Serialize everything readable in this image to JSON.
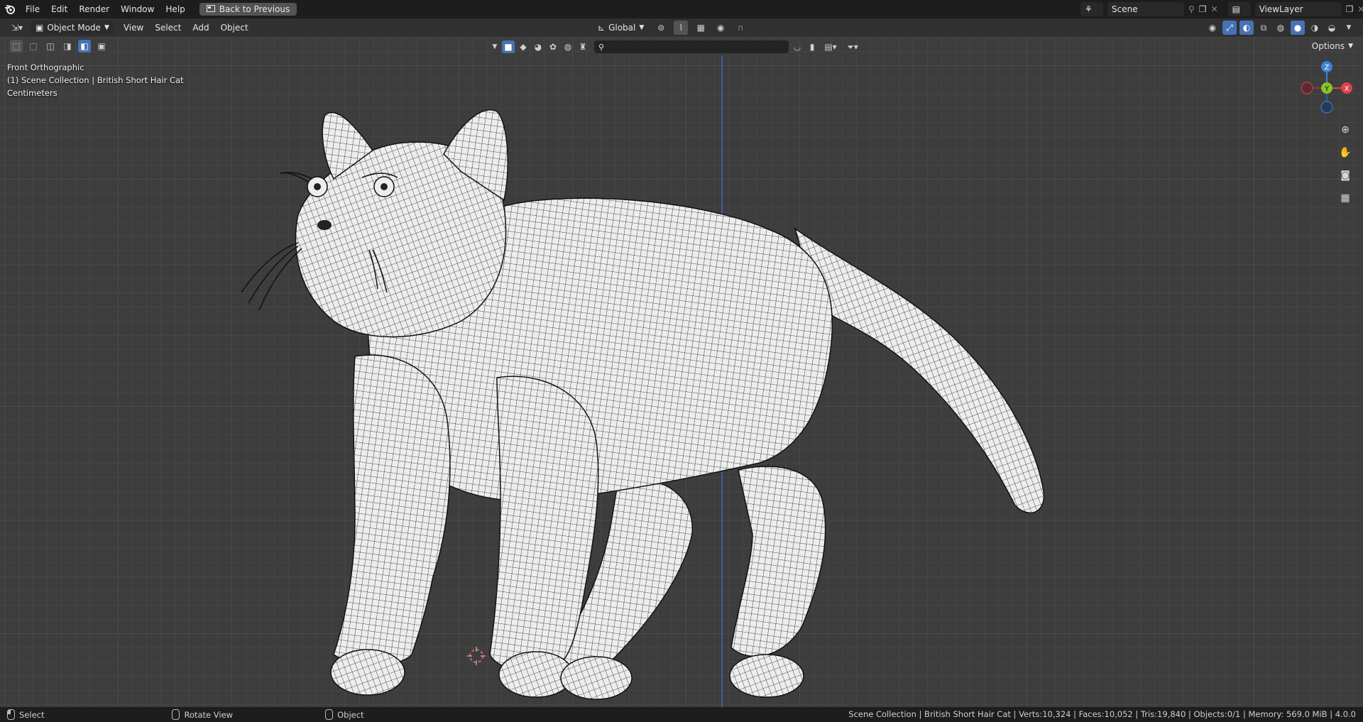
{
  "menu": {
    "items": [
      "File",
      "Edit",
      "Render",
      "Window",
      "Help"
    ],
    "back_button": "Back to Previous"
  },
  "workspace": {
    "scene_label": "Scene",
    "view_layer_label": "ViewLayer"
  },
  "header": {
    "mode": "Object Mode",
    "menus": [
      "View",
      "Select",
      "Add",
      "Object"
    ],
    "transform_orientation": "Global",
    "options_label": "Options"
  },
  "viewport": {
    "view_name": "Front Orthographic",
    "collection_line": "(1) Scene Collection | British Short Hair Cat",
    "units": "Centimeters",
    "gizmo": {
      "z": "Z",
      "y": "Y",
      "x": "X"
    }
  },
  "statusbar": {
    "left": [
      {
        "label": "Select"
      },
      {
        "label": "Rotate View"
      },
      {
        "label": "Object"
      }
    ],
    "stats": "Scene Collection | British Short Hair Cat | Verts:10,324 | Faces:10,052 | Tris:19,840 | Objects:0/1 | Memory: 569.0 MiB | 4.0.0"
  },
  "colors": {
    "accent": "#4772b3",
    "axis_x": "#e0414f",
    "axis_y": "#8bc328",
    "axis_z": "#3d83d8"
  }
}
